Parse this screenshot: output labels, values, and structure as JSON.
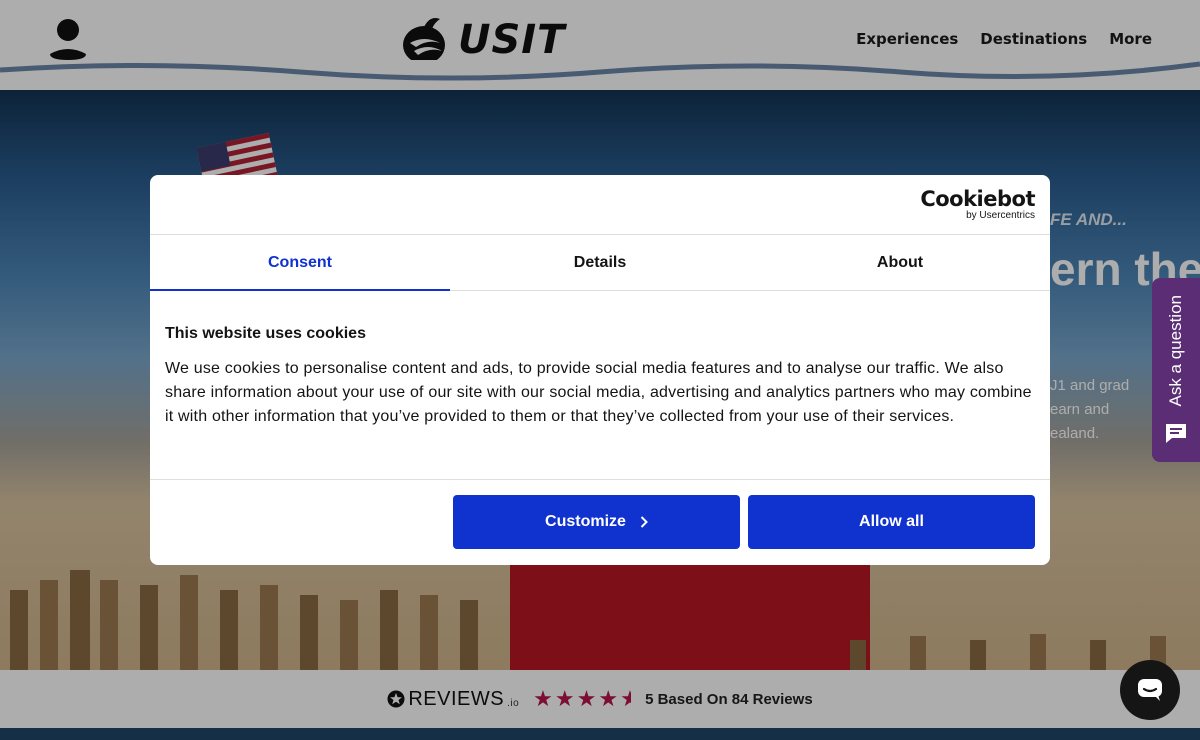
{
  "header": {
    "logo_text": "USIT",
    "nav": [
      "Experiences",
      "Destinations",
      "More"
    ]
  },
  "hero": {
    "tagline": "FE AND...",
    "headline": "ern the",
    "description_lines": [
      "J1 and grad",
      "earn and",
      "ealand."
    ]
  },
  "side_tab": {
    "label": "Ask a question"
  },
  "cookie_dialog": {
    "brand": "Cookiebot",
    "brand_sub": "by Usercentrics",
    "tabs": [
      "Consent",
      "Details",
      "About"
    ],
    "active_tab": "Consent",
    "title": "This website uses cookies",
    "body": "We use cookies to personalise content and ads, to provide social media features and to analyse our traffic. We also share information about your use of our site with our social media, advertising and analytics partners who may combine it with other information that you’ve provided to them or that they’ve collected from your use of their services.",
    "customize_label": "Customize",
    "allow_all_label": "Allow all",
    "accent_color": "#1032cf"
  },
  "reviews": {
    "brand": "REVIEWS",
    "brand_suffix": ".io",
    "rating_stars": 4.5,
    "summary": "5 Based On 84 Reviews",
    "star_color": "#b5154b"
  },
  "icons": [
    "account-icon",
    "usit-bird-logo-icon",
    "chevron-right-icon",
    "chat-bubble-icon",
    "star-icon",
    "message-icon"
  ]
}
